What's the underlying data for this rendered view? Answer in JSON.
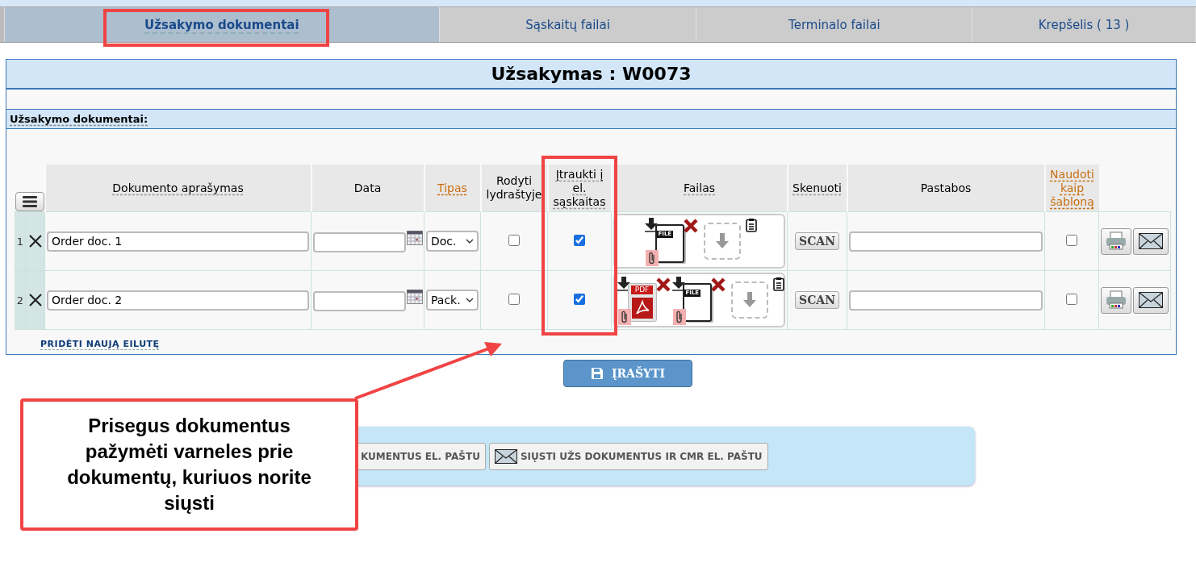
{
  "tabs": [
    {
      "label": "Užsakymo dokumentai",
      "selected": true
    },
    {
      "label": "Sąskaitų failai",
      "selected": false
    },
    {
      "label": "Terminalo failai",
      "selected": false
    },
    {
      "label": "Krepšelis ( 13 )",
      "selected": false
    }
  ],
  "order_title": "Užsakymas : W0073",
  "section_label": "Užsakymo dokumentai:",
  "columns": [
    {
      "label": "Dokumento aprašymas",
      "kind": "hint"
    },
    {
      "label": "Data",
      "kind": "plain"
    },
    {
      "label": "Tipas",
      "kind": "link"
    },
    {
      "label": "Rodyti lydraštyje",
      "kind": "plain"
    },
    {
      "label": "Įtraukti į el. sąskaitas",
      "kind": "hint"
    },
    {
      "label": "Failas",
      "kind": "hint"
    },
    {
      "label": "Skenuoti",
      "kind": "hint"
    },
    {
      "label": "Pastabos",
      "kind": "plain"
    },
    {
      "label": "Naudoti kaip šabloną",
      "kind": "link"
    }
  ],
  "rows": [
    {
      "number": "1",
      "description": "Order doc. 1",
      "type": "Doc.",
      "show_in_waybill": false,
      "include_in_invoices": true,
      "files": [
        {
          "kind": "file",
          "label": "FILE"
        }
      ],
      "scan": "SCAN",
      "use_as_template": false
    },
    {
      "number": "2",
      "description": "Order doc. 2",
      "type": "Pack.",
      "show_in_waybill": false,
      "include_in_invoices": true,
      "files": [
        {
          "kind": "pdf",
          "label": "PDF"
        },
        {
          "kind": "file",
          "label": "FILE"
        }
      ],
      "scan": "SCAN",
      "use_as_template": false
    }
  ],
  "add_row_link": "PRIDĖTI NAUJĄ EILUTĘ",
  "save_button": "ĮRAŠYTI",
  "send_buttons": [
    "KUMENTUS EL. PAŠTU",
    "SIŲSTI UŽS DOKUMENTUS IR CMR EL. PAŠTU"
  ],
  "callout": "Prisegus dokumentus pažymėti varneles prie dokumentų, kuriuos norite siųsti"
}
